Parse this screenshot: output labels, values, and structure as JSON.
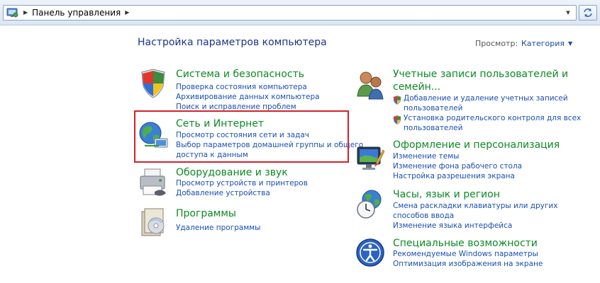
{
  "address": {
    "breadcrumb": "Панель управления"
  },
  "header": {
    "title": "Настройка параметров компьютера",
    "view_label": "Просмотр:",
    "view_value": "Категория"
  },
  "categories_left": [
    {
      "title": "Система и безопасность",
      "icon": "shield-flag-icon",
      "links": [
        "Проверка состояния компьютера",
        "Архивирование данных компьютера",
        "Поиск и исправление проблем"
      ]
    },
    {
      "title": "Сеть и Интернет",
      "icon": "globe-network-icon",
      "links": [
        "Просмотр состояния сети и задач",
        "Выбор параметров домашней группы и общего",
        "доступа к данным"
      ]
    },
    {
      "title": "Оборудование и звук",
      "icon": "printer-icon",
      "links": [
        "Просмотр устройств и принтеров",
        "Добавление устройства"
      ]
    },
    {
      "title": "Программы",
      "icon": "programs-disc-icon",
      "links": [
        "Удаление программы"
      ]
    }
  ],
  "categories_right": [
    {
      "title_line1": "Учетные записи пользователей и",
      "title_line2": "семейн...",
      "icon": "users-icon",
      "links": [
        "Добавление и удаление учетных записей",
        "пользователей",
        "Установка родительского контроля для всех",
        "пользователей"
      ]
    },
    {
      "title": "Оформление и персонализация",
      "icon": "monitor-brush-icon",
      "links": [
        "Изменение темы",
        "Изменение фона рабочего стола",
        "Настройка разрешения экрана"
      ]
    },
    {
      "title": "Часы, язык и регион",
      "icon": "clock-globe-icon",
      "links": [
        "Смена раскладки клавиатуры или других",
        "способов ввода",
        "Изменение языка интерфейса"
      ]
    },
    {
      "title": "Специальные возможности",
      "icon": "accessibility-icon",
      "links": [
        "Рекомендуемые Windows параметры",
        "Оптимизация изображения на экране"
      ]
    }
  ]
}
